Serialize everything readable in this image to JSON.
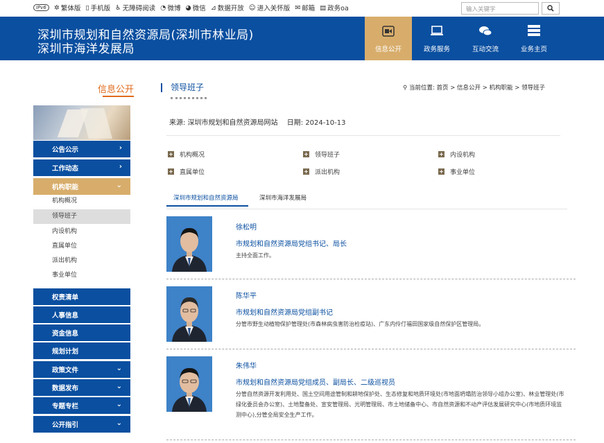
{
  "topbar": {
    "links": [
      {
        "label": "IPv6",
        "icon": "ipv6-badge"
      },
      {
        "label": "繁体版",
        "icon": "gear-icon"
      },
      {
        "label": "手机版",
        "icon": "mobile-icon"
      },
      {
        "label": "无障碍阅读",
        "icon": "accessibility-icon"
      },
      {
        "label": "微博",
        "icon": "weibo-icon"
      },
      {
        "label": "微信",
        "icon": "wechat-icon"
      },
      {
        "label": "数据开放",
        "icon": "chart-icon"
      },
      {
        "label": "进入关怀版",
        "icon": "care-icon"
      },
      {
        "label": "邮箱",
        "icon": "mail-icon"
      },
      {
        "label": "政务oa",
        "icon": "oa-icon"
      }
    ],
    "search_placeholder": "输入关键字"
  },
  "header": {
    "title_line1": "深圳市规划和自然资源局(深圳市林业局)",
    "title_line2": "深圳市海洋发展局",
    "nav": [
      {
        "label": "信息公开",
        "active": true,
        "icon": "video-icon"
      },
      {
        "label": "政务服务",
        "active": false,
        "icon": "laptop-icon"
      },
      {
        "label": "互动交流",
        "active": false,
        "icon": "chat-icon"
      },
      {
        "label": "业务主页",
        "active": false,
        "icon": "server-icon"
      }
    ]
  },
  "sidebar": {
    "title": "信息公开",
    "menu_top": [
      {
        "label": "公告公示"
      },
      {
        "label": "工作动态"
      },
      {
        "label": "机构职能"
      }
    ],
    "sub_items": [
      "机构概况",
      "领导班子",
      "内设机构",
      "直属单位",
      "派出机构",
      "事业单位"
    ],
    "active_sub": "领导班子",
    "menu_bottom": [
      {
        "label": "权责清单"
      },
      {
        "label": "人事信息"
      },
      {
        "label": "资金信息"
      },
      {
        "label": "规划计划"
      },
      {
        "label": "政策文件"
      },
      {
        "label": "数据发布"
      },
      {
        "label": "专题专栏"
      },
      {
        "label": "公开指引"
      }
    ]
  },
  "content": {
    "title": "领导班子",
    "breadcrumb": "当前位置: 首页 > 信息公开 > 机构职能 > 领导班子",
    "source_label": "来源:",
    "source": "深圳市规划和自然资源局网站",
    "date_label": "日期:",
    "date": "2024-10-13",
    "links": [
      "机构概况",
      "领导班子",
      "内设机构",
      "直属单位",
      "派出机构",
      "事业单位"
    ],
    "tabs": [
      "深圳市规划和自然资源局",
      "深圳市海洋发展局"
    ],
    "leaders": [
      {
        "name": "徐松明",
        "position": "市规划和自然资源局党组书记、局长",
        "duty": "主持全面工作。"
      },
      {
        "name": "陈华平",
        "position": "市规划和自然资源局党组副书记",
        "duty": "分管市野生动植物保护管理处(市森林病虫害防治检疫站)、广东内伶仃福田国家级自然保护区管理局。"
      },
      {
        "name": "朱伟华",
        "position": "市规划和自然资源局党组成员、副局长、二级巡视员",
        "duty": "分管自然资源开发利用处、国土空间用途管制和耕地保护处、生态修复和地质环境处(市地面坍塌防治领导小组办公室)、林业管理处(市绿化委员会办公室)、土地整备处、宣安管理局、光明管理局、市土地储备中心、市自然资源和不动产评估发展研究中心(市地质环境监测中心),分管全局安全生产工作。"
      }
    ]
  }
}
